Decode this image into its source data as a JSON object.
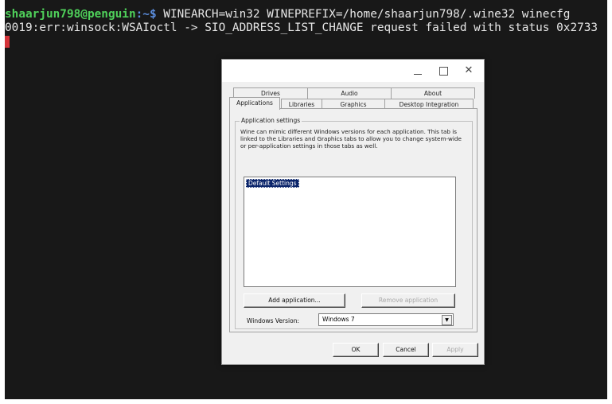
{
  "terminal": {
    "prompt_user": "shaarjun798@penguin",
    "prompt_path": ":~$",
    "command": " WINEARCH=win32 WINEPREFIX=/home/shaarjun798/.wine32 winecfg",
    "output_line": "0019:err:winsock:WSAIoctl -> SIO_ADDRESS_LIST_CHANGE request failed with status 0x2733"
  },
  "dialog": {
    "title_buttons": {
      "minimize": "_",
      "maximize": "□",
      "close": "✕"
    },
    "tabs_row1": [
      "Drives",
      "Audio",
      "About"
    ],
    "tabs_row2": [
      "Applications",
      "Libraries",
      "Graphics",
      "Desktop Integration"
    ],
    "active_tab": "Applications",
    "group_title": "Application settings",
    "description": "Wine can mimic different Windows versions for each application. This tab is linked to the Libraries and Graphics tabs to allow you to change system-wide or per-application settings in those tabs as well.",
    "app_list": [
      "Default Settings"
    ],
    "add_button": "Add application...",
    "remove_button": "Remove application",
    "windows_version_label": "Windows Version:",
    "windows_version_value": "Windows 7",
    "ok_button": "OK",
    "cancel_button": "Cancel",
    "apply_button": "Apply"
  }
}
